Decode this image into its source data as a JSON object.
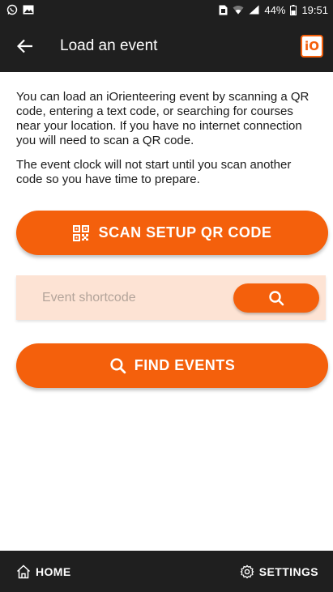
{
  "status_bar": {
    "battery": "44%",
    "time": "19:51"
  },
  "app_bar": {
    "title": "Load an event",
    "logo_text": "iO"
  },
  "intro": {
    "paragraph1": "You can load an iOrienteering event by scanning a QR code, entering a text code, or searching for courses near your location. If you have no internet connection you will need to scan a QR code.",
    "paragraph2": "The event clock will not start until you scan another code so you have time to prepare."
  },
  "scan_button": {
    "label": "SCAN SETUP QR CODE",
    "icon": "qr-code-icon"
  },
  "shortcode": {
    "placeholder": "Event shortcode",
    "value": "",
    "icon": "search-icon"
  },
  "find_button": {
    "label": "FIND EVENTS",
    "icon": "search-icon"
  },
  "bottom_nav": {
    "home_label": "HOME",
    "settings_label": "SETTINGS"
  },
  "colors": {
    "accent": "#f4600c",
    "bar_background": "#1f1f1f",
    "input_background": "#fde3d4"
  }
}
